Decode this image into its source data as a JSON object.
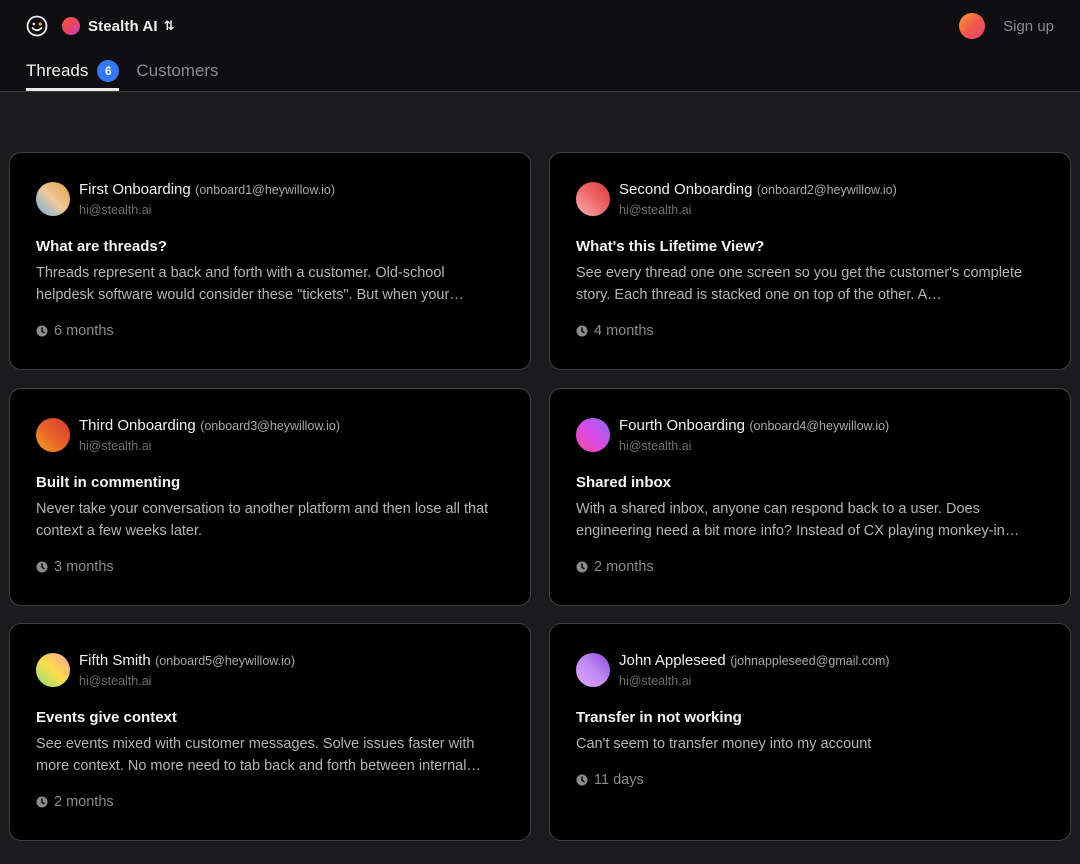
{
  "app": {
    "org_name": "Stealth AI",
    "switch_icon": "⇅",
    "logo_icon": "wink-face-icon",
    "signup_label": "Sign up"
  },
  "tabs": [
    {
      "label": "Threads",
      "badge": "6",
      "active": true
    },
    {
      "label": "Customers",
      "active": false
    }
  ],
  "colors": {
    "accent": "#3478f6",
    "header_bg": "#0e0e10",
    "page_bg": "#1b1b1d",
    "card_bg": "#000000"
  },
  "threads": [
    {
      "name": "First Onboarding",
      "email": "(onboard1@heywillow.io)",
      "agent": "hi@stealth.ai",
      "subject": "What are threads?",
      "preview": "Threads represent a back and forth with a customer. Old-school helpdesk software would consider these \"tickets\". But when your…",
      "time": "6 months",
      "avatar_gradient": [
        "#6aaee6",
        "#f0c89a",
        "#e2a24a"
      ]
    },
    {
      "name": "Second Onboarding",
      "email": "(onboard2@heywillow.io)",
      "agent": "hi@stealth.ai",
      "subject": "What's this Lifetime View?",
      "preview": "See every thread one one screen so you get the customer's complete story. Each thread is stacked one on top of the other. A…",
      "time": "4 months",
      "avatar_gradient": [
        "#fbb4b4",
        "#ef6a6a",
        "#d83a3a"
      ]
    },
    {
      "name": "Third Onboarding",
      "email": "(onboard3@heywillow.io)",
      "agent": "hi@stealth.ai",
      "subject": "Built in commenting",
      "preview": "Never take your conversation to another platform and then lose all that context a few weeks later.",
      "time": "3 months",
      "avatar_gradient": [
        "#f0a020",
        "#e8602a",
        "#d83a2a"
      ]
    },
    {
      "name": "Fourth Onboarding",
      "email": "(onboard4@heywillow.io)",
      "agent": "hi@stealth.ai",
      "subject": "Shared inbox",
      "preview": "With a shared inbox, anyone can respond back to a user. Does engineering need a bit more info? Instead of CX playing monkey-in…",
      "time": "2 months",
      "avatar_gradient": [
        "#f54ea2",
        "#d94ae8",
        "#8a6cf0"
      ]
    },
    {
      "name": "Fifth Smith",
      "email": "(onboard5@heywillow.io)",
      "agent": "hi@stealth.ai",
      "subject": "Events give context",
      "preview": "See events mixed with customer messages. Solve issues faster with more context. No more need to tab back and forth between internal…",
      "time": "2 months",
      "avatar_gradient": [
        "#8fe07a",
        "#fbdc4a",
        "#f9a0a0"
      ]
    },
    {
      "name": "John Appleseed",
      "email": "(johnappleseed@gmail.com)",
      "agent": "hi@stealth.ai",
      "subject": "Transfer in not working",
      "preview": "Can't seem to transfer money into my account",
      "time": "11 days",
      "avatar_gradient": [
        "#e0a8ff",
        "#c08af5",
        "#8a4ad8"
      ]
    }
  ]
}
